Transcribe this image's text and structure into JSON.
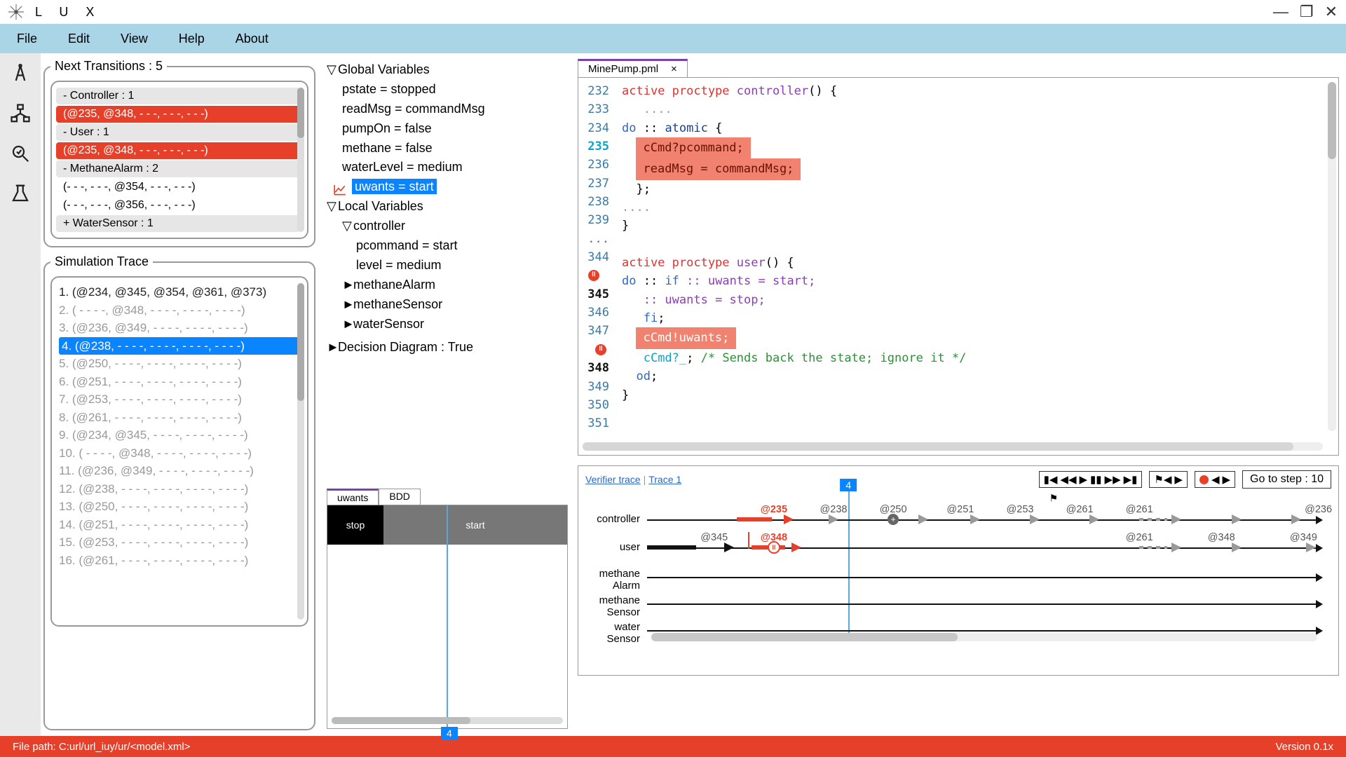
{
  "app": {
    "title": "L U X",
    "version": "Version 0.1x",
    "filepath": "File path: C:url/url_iuy/ur/<model.xml>"
  },
  "menu": {
    "file": "File",
    "edit": "Edit",
    "view": "View",
    "help": "Help",
    "about": "About"
  },
  "transitions": {
    "title": "Next Transitions : 5",
    "items": [
      {
        "text": "-  Controller : 1",
        "kind": "header"
      },
      {
        "text": "(@235, @348, - - -, - - -, - - -)",
        "kind": "active"
      },
      {
        "text": "-  User : 1",
        "kind": "header"
      },
      {
        "text": "(@235, @348, - - -, - - -, - - -)",
        "kind": "active"
      },
      {
        "text": "-  MethaneAlarm : 2",
        "kind": "header"
      },
      {
        "text": "(- - -, - - -, @354, - - -, - - -)",
        "kind": "plain"
      },
      {
        "text": "(- - -, - - -, @356, - - -, - - -)",
        "kind": "plain"
      },
      {
        "text": "+  WaterSensor : 1",
        "kind": "plus"
      }
    ]
  },
  "trace": {
    "title": "Simulation Trace",
    "rows": [
      "1. (@234, @345, @354, @361, @373)",
      "2. (   - - - -, @348,    - - - -,   - - - -,    - - - -)",
      "3. (@236, @349,    - - - -,   - - - -,    - - - -)",
      "4. (@238,    - - - -,    - - - -,   - - - -,    - - - -)",
      "5. (@250,    - - - -,    - - - -,   - - - -,    - - - -)",
      "6. (@251,    - - - -,    - - - -,   - - - -,    - - - -)",
      "7. (@253,    - - - -,    - - - -,   - - - -,    - - - -)",
      "8. (@261,    - - - -,    - - - -,   - - - -,    - - - -)",
      "9. (@234, @345,    - - - -,   - - - -,    - - - -)",
      "10. (   - - - -, @348,    - - - -,   - - - -,    - - - -)",
      "11. (@236, @349,    - - - -,   - - - -,    - - - -)",
      "12. (@238,    - - - -,    - - - -,   - - - -,    - - - -)",
      "13. (@250,    - - - -,    - - - -,   - - - -,    - - - -)",
      "14. (@251,    - - - -,    - - - -,   - - - -,    - - - -)",
      "15. (@253,    - - - -,    - - - -,   - - - -,    - - - -)",
      "16. (@261,    - - - -,    - - - -,   - - - -,    - - - -)"
    ],
    "selected_index": 3
  },
  "globals": {
    "header": "Global Variables",
    "items": [
      "pstate = stopped",
      "readMsg = commandMsg",
      "pumpOn = false",
      "methane = false",
      "waterLevel = medium"
    ],
    "highlight": "uwants = start"
  },
  "locals": {
    "header": "Local Variables",
    "controller_label": "controller",
    "controller_items": [
      "pcommand = start",
      "level = medium"
    ],
    "collapsed": [
      "methaneAlarm",
      "methaneSensor",
      "waterSensor"
    ]
  },
  "decision": "Decision Diagram : True",
  "panel_tabs": {
    "a": "uwants",
    "b": "BDD"
  },
  "uwants_cells": {
    "stop": "stop",
    "start": "start",
    "step": "4"
  },
  "file_tab": {
    "name": "MinePump.pml",
    "close": "×"
  },
  "code_lines": {
    "232": {
      "num": "232"
    },
    "233": {
      "num": "233"
    },
    "234": {
      "num": "234"
    },
    "235": {
      "num": "235"
    },
    "236": {
      "num": "236"
    },
    "237": {
      "num": "237"
    },
    "238": {
      "num": "238"
    },
    "239": {
      "num": "239"
    },
    "ell": {
      "num": "..."
    },
    "344": {
      "num": "344"
    },
    "345": {
      "num": "345"
    },
    "346": {
      "num": "346"
    },
    "347": {
      "num": "347"
    },
    "348": {
      "num": "348"
    },
    "349": {
      "num": "349"
    },
    "350": {
      "num": "350"
    },
    "351": {
      "num": "351"
    }
  },
  "code": {
    "l232_a": "active proctype",
    "l232_b": " controller",
    "l232_c": "() {",
    "l233": "....",
    "l234_a": "do",
    "l234_b": " :: ",
    "l234_c": "atomic",
    "l234_d": " {",
    "l235": "cCmd?pcommand;",
    "l236": "readMsg = commandMsg;",
    "l237": "};",
    "l238": "....",
    "l239": "}",
    "l344_a": "active proctype",
    "l344_b": " user",
    "l344_c": "() {",
    "l345_a": "do",
    "l345_b": " :: ",
    "l345_c": "if",
    "l345_d": " :: uwants = start;",
    "l346": ":: uwants = stop;",
    "l347": "fi",
    "l347b": ";",
    "l348": "cCmd!uwants;",
    "l349_a": "cCmd?_",
    "l349_b": ";   ",
    "l349_c": "/* Sends back the state; ignore it */",
    "l350_a": "od",
    "l350_b": ";",
    "l351": "}"
  },
  "timeline": {
    "tab1": "Verifier trace",
    "tab2": "Trace 1",
    "goto": "Go to step : 10",
    "step_badge": "4",
    "lanes": [
      "controller",
      "user",
      "methane\nAlarm",
      "methane\nSensor",
      "water\nSensor"
    ],
    "ctrl_marks": [
      {
        "label": "@235",
        "x": 17,
        "red": true
      },
      {
        "label": "@238",
        "x": 25
      },
      {
        "label": "@250",
        "x": 33
      },
      {
        "label": "@251",
        "x": 42
      },
      {
        "label": "@253",
        "x": 50
      },
      {
        "label": "@261",
        "x": 58
      },
      {
        "label": "@261",
        "x": 66
      },
      {
        "label": "@236",
        "x": 90
      }
    ],
    "user_marks": [
      {
        "label": "@345",
        "x": 9,
        "black": true
      },
      {
        "label": "@348",
        "x": 17,
        "red": true
      },
      {
        "label": "@261",
        "x": 66
      },
      {
        "label": "@348",
        "x": 77
      },
      {
        "label": "@349",
        "x": 88
      }
    ]
  }
}
